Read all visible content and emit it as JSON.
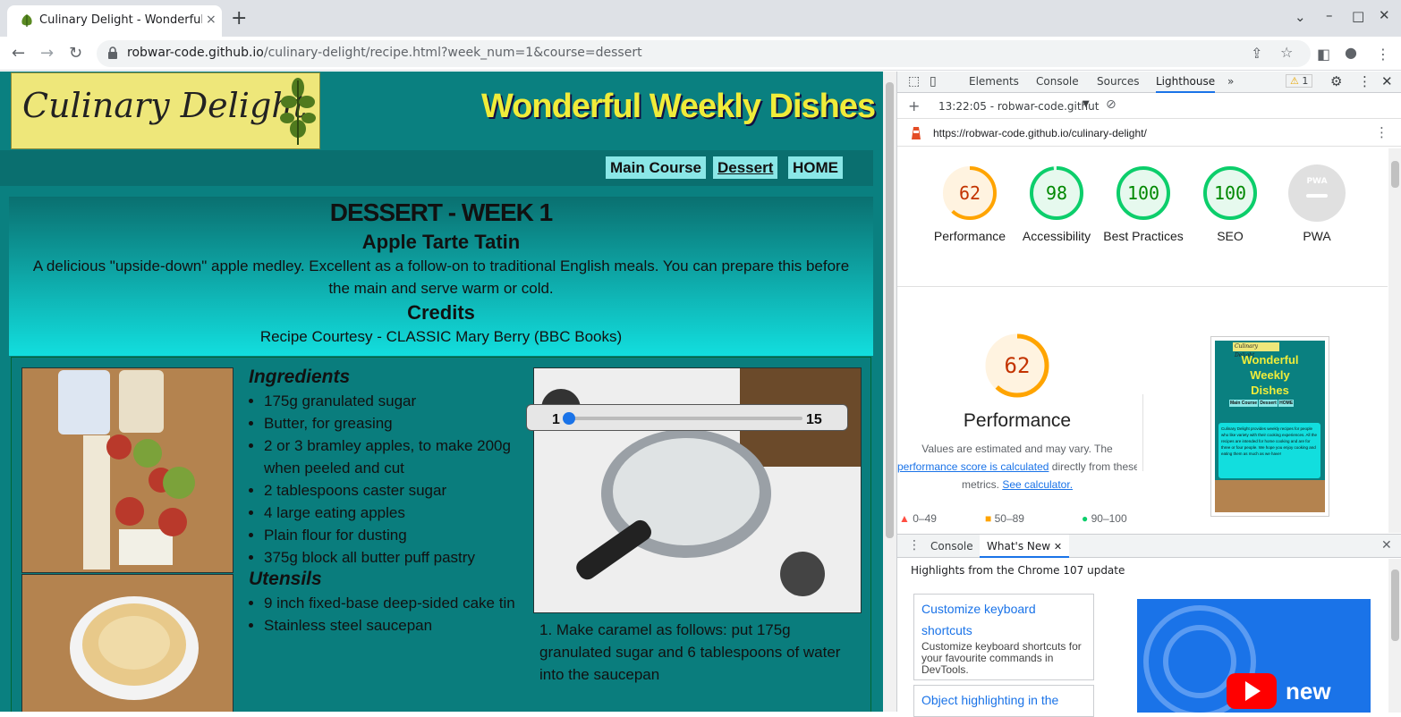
{
  "browser": {
    "tab_title": "Culinary Delight - Wonderful W",
    "url_host": "robwar-code.github.io",
    "url_path": "/culinary-delight/recipe.html?week_num=1&course=dessert",
    "new_tab": "+",
    "tab_close": "×"
  },
  "site": {
    "logo_text": "Culinary Delight",
    "title": "Wonderful Weekly Dishes",
    "nav": [
      "Main Course",
      "Dessert",
      "HOME"
    ],
    "heading": "DESSERT - WEEK 1",
    "dish": "Apple Tarte Tatin",
    "description_1": "A delicious \"upside-down\" apple medley. Excellent as a follow-on to traditional English meals. You can prepare this before",
    "description_2": "the main and serve warm or cold.",
    "credits_heading": "Credits",
    "credits": "Recipe Courtesy - CLASSIC Mary Berry (BBC Books)",
    "ingredients_heading": "Ingredients",
    "ingredients": [
      "175g granulated sugar",
      "Butter, for greasing",
      "2 or 3 bramley apples, to make 200g when peeled and cut",
      "2 tablespoons caster sugar",
      "4 large eating apples",
      "Plain flour for dusting",
      "375g block all butter puff pastry"
    ],
    "utensils_heading": "Utensils",
    "utensils": [
      "9 inch fixed-base deep-sided cake tin",
      "Stainless steel saucepan"
    ],
    "step": "1. Make caramel as follows: put 175g granulated sugar and 6 tablespoons of water into the saucepan",
    "slider_min": "1",
    "slider_max": "15"
  },
  "devtools": {
    "tabs": [
      "Elements",
      "Console",
      "Sources",
      "Lighthouse",
      "»"
    ],
    "warnings": "1",
    "report_time": "13:22:05 - robwar-code.githut",
    "report_url": "https://robwar-code.github.io/culinary-delight/",
    "scores": [
      {
        "label": "Performance",
        "value": "62",
        "fraction": 0.62,
        "color": "#ffa400"
      },
      {
        "label": "Accessibility",
        "value": "98",
        "fraction": 0.98,
        "color": "#0cce6b"
      },
      {
        "label": "Best Practices",
        "value": "100",
        "fraction": 1.0,
        "color": "#0cce6b"
      },
      {
        "label": "SEO",
        "value": "100",
        "fraction": 1.0,
        "color": "#0cce6b"
      },
      {
        "label": "PWA",
        "value": "PWA",
        "fraction": 0,
        "color": "#9e9e9e"
      }
    ],
    "perf_score": "62",
    "perf_title": "Performance",
    "perf_note_1": "Values are estimated and may vary. The",
    "perf_link": "performance score is calculated",
    "perf_note_2": "directly from these",
    "perf_note_3": "metrics.",
    "calc_link": "See calculator.",
    "legend": [
      "0–49",
      "50–89",
      "90–100"
    ],
    "thumb": {
      "logo": "Culinary Delight",
      "title_1": "Wonderful",
      "title_2": "Weekly",
      "title_3": "Dishes",
      "nav": [
        "Main Course",
        "Dessert",
        "HOME"
      ],
      "blurb": "Culinary Delight provides weekly recipes for people who like variety with their cooking experiences. All the recipes are intended for home cooking and are for three or four people. We hope you enjoy cooking and eating them as much as we have!"
    },
    "drawer_tabs": [
      "Console",
      "What's New"
    ],
    "drawer_heading": "Highlights from the Chrome 107 update",
    "card1_title": "Customize keyboard shortcuts",
    "card1_desc": "Customize keyboard shortcuts for your favourite commands in DevTools.",
    "card2_title": "Object highlighting in the",
    "video_text": "new"
  }
}
